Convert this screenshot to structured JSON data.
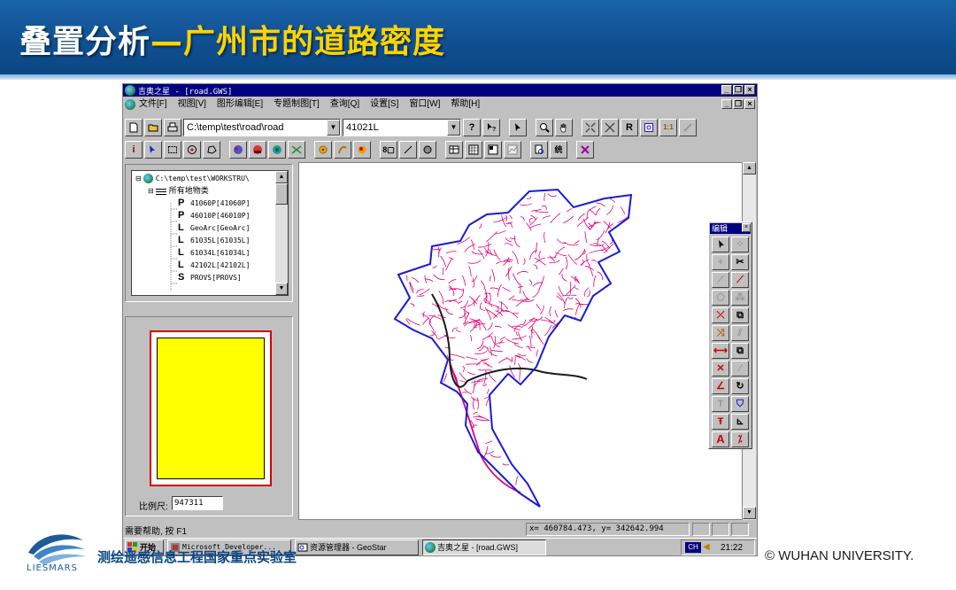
{
  "slide": {
    "title_main": "叠置分析",
    "title_sub": "—广州市的道路密度",
    "lab_text": "测绘遥感信息工程国家重点实验室",
    "copyright": "© WUHAN UNIVERSITY.",
    "logo_text": "LIESMARS"
  },
  "window": {
    "title": "吉奥之星 - [road.GWS]",
    "min_glyph": "_",
    "max_glyph": "❐",
    "close_glyph": "×",
    "menus": [
      "文件[F]",
      "视图[V]",
      "图形编辑[E]",
      "专题制图[T]",
      "查询[Q]",
      "设置[S]",
      "窗口[W]",
      "帮助[H]"
    ]
  },
  "toolbar": {
    "path_value": "C:\\temp\\test\\road\\road",
    "layer_value": "41021L",
    "help_glyph": "?",
    "r_label": "R",
    "ratio_label": "1:1",
    "a_label": "A"
  },
  "tree": {
    "root": "C:\\temp\\test\\WORKSTRU\\",
    "group": "所有地物类",
    "items": [
      {
        "type": "P",
        "label": "41060P[41060P]"
      },
      {
        "type": "P",
        "label": "46010P[46010P]"
      },
      {
        "type": "L",
        "label": "GeoArc[GeoArc]"
      },
      {
        "type": "L",
        "label": "61035L[61035L]"
      },
      {
        "type": "L",
        "label": "61034L[61034L]"
      },
      {
        "type": "L",
        "label": "42102L[42102L]"
      },
      {
        "type": "S",
        "label": "PROVS[PROVS]"
      }
    ]
  },
  "overview": {
    "scale_label": "比例尺:",
    "scale_value": "947311"
  },
  "palette": {
    "title": "编辑",
    "close_glyph": "×",
    "t_label": "T",
    "a_label": "A"
  },
  "status": {
    "help": "需要帮助, 按 F1",
    "coords": "x= 460784.473, y= 342642.994"
  },
  "taskbar": {
    "start": "开始",
    "tasks": [
      "Microsoft Developer...",
      "资源管理器 - GeoStar",
      "吉奥之星 - [road.GWS]"
    ],
    "ime": "CH",
    "time": "21:22"
  },
  "colors": {
    "roads": "#e0007a",
    "boundary": "#1a1ad6",
    "highway": "#1a1a1a",
    "overview_frame": "#d40000",
    "overview_fill": "#ffff00"
  }
}
